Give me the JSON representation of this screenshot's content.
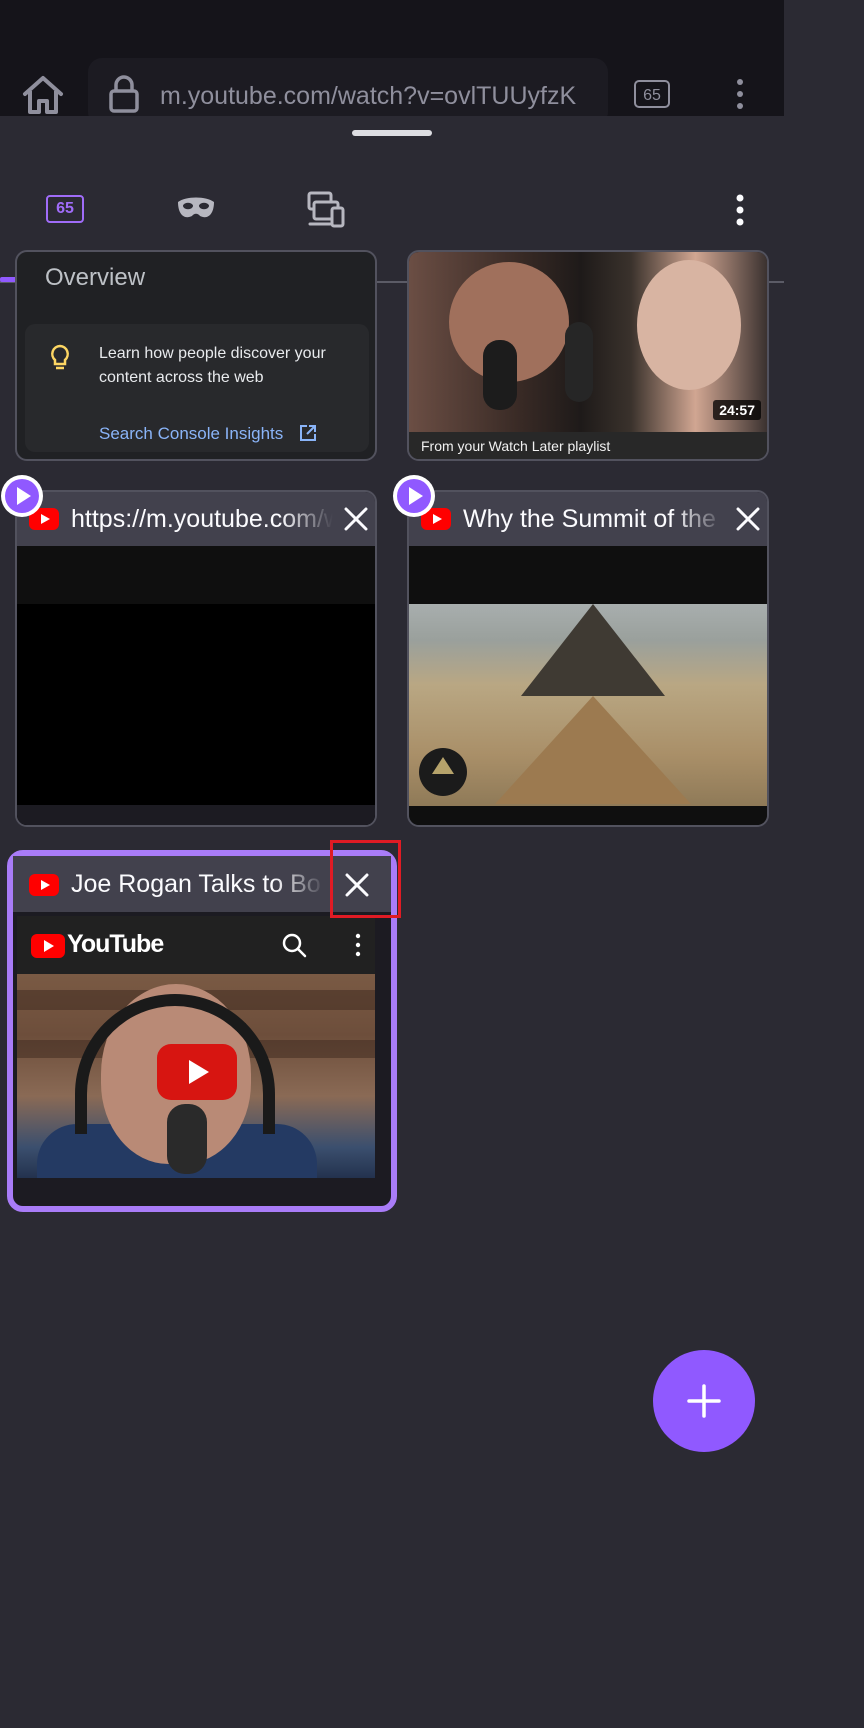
{
  "toolbar": {
    "url": "m.youtube.com/watch?v=ovlTUUyfzK",
    "tab_count": "65"
  },
  "sheet": {
    "tab_count": "65",
    "tabs": [
      "normal",
      "private",
      "synced"
    ]
  },
  "cards": {
    "search_console": {
      "overview": "Overview",
      "insight_text": "Learn how people discover your content across the web",
      "insight_link": "Search Console Insights"
    },
    "rogan_musk": {
      "duration": "24:57",
      "caption": "From your Watch Later playlist"
    },
    "yt_blank": {
      "title": "https://m.youtube.com/watch"
    },
    "summit": {
      "title": "Why the Summit of the"
    },
    "active": {
      "title": "Joe Rogan Talks to Bo",
      "site_logo_text": "YouTube"
    }
  },
  "colors": {
    "accent": "#9059ff",
    "highlight": "#e01b24",
    "background": "#2b2a33"
  },
  "icons": [
    "home-icon",
    "lock-icon",
    "menu-icon",
    "private-mask-icon",
    "synced-devices-icon",
    "close-icon",
    "play-icon",
    "plus-icon",
    "lightbulb-icon",
    "external-link-icon",
    "search-icon"
  ]
}
